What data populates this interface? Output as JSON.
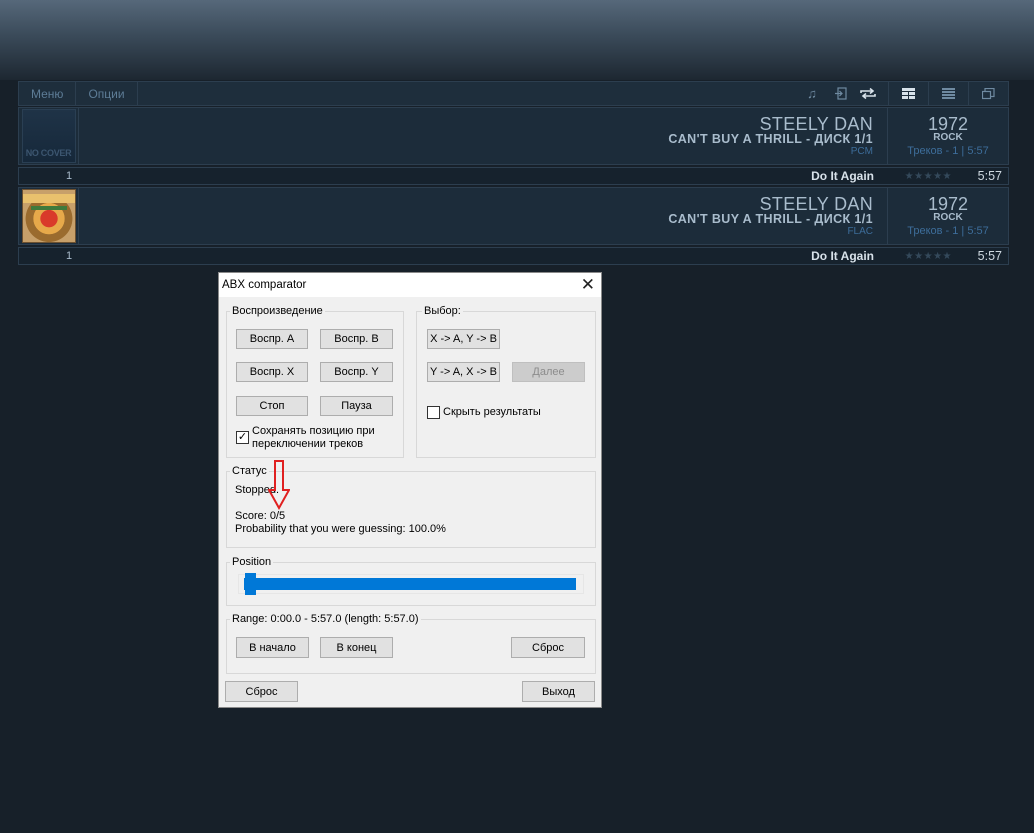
{
  "menubar": {
    "items": [
      "Меню",
      "Опции"
    ],
    "icons": [
      "music-note-icon",
      "import-icon",
      "repeat-icon"
    ],
    "view_buttons": [
      "grid-view-icon",
      "list-view-icon",
      "window-icon"
    ]
  },
  "albums": [
    {
      "cover": "NO COVER",
      "artist": "STEELY DAN",
      "album": "CAN'T BUY A THRILL - ДИСК 1/1",
      "format": "PCM",
      "year": "1972",
      "genre": "ROCK",
      "tracks": "Треков - 1  | 5:57",
      "track": {
        "num": "1",
        "title": "Do It Again",
        "stars": "★★★★★",
        "duration": "5:57"
      }
    },
    {
      "cover": "",
      "artist": "STEELY DAN",
      "album": "CAN'T BUY A THRILL - ДИСК 1/1",
      "format": "FLAC",
      "year": "1972",
      "genre": "ROCK",
      "tracks": "Треков - 1  | 5:57",
      "track": {
        "num": "1",
        "title": "Do It Again",
        "stars": "★★★★★",
        "duration": "5:57"
      }
    }
  ],
  "dialog": {
    "title": "ABX comparator",
    "close": "✕",
    "playback": {
      "label": "Воспроизведение",
      "play_a": "Воспр. A",
      "play_b": "Воспр. B",
      "play_x": "Воспр. X",
      "play_y": "Воспр. Y",
      "stop": "Стоп",
      "pause": "Пауза",
      "keep_position_checked": true,
      "keep_position_line1": "Сохранять позицию при",
      "keep_position_line2": "переключении треков"
    },
    "choice": {
      "label": "Выбор:",
      "xa_yb": "X -> A, Y -> B",
      "ya_xb": "Y -> A, X -> B",
      "next": "Далее",
      "hide_results_checked": false,
      "hide_results": "Скрыть результаты"
    },
    "status": {
      "label": "Статус",
      "state": "Stopped.",
      "score": "Score: 0/5",
      "probability": "Probability that you were guessing: 100.0%"
    },
    "position": {
      "label": "Position",
      "value": 0.0
    },
    "range": {
      "label": "Range: 0:00.0 - 5:57.0 (length: 5:57.0)",
      "to_start": "В начало",
      "to_end": "В конец",
      "reset": "Сброс"
    },
    "footer": {
      "reset": "Сброс",
      "exit": "Выход"
    },
    "check_mark": "✓"
  }
}
